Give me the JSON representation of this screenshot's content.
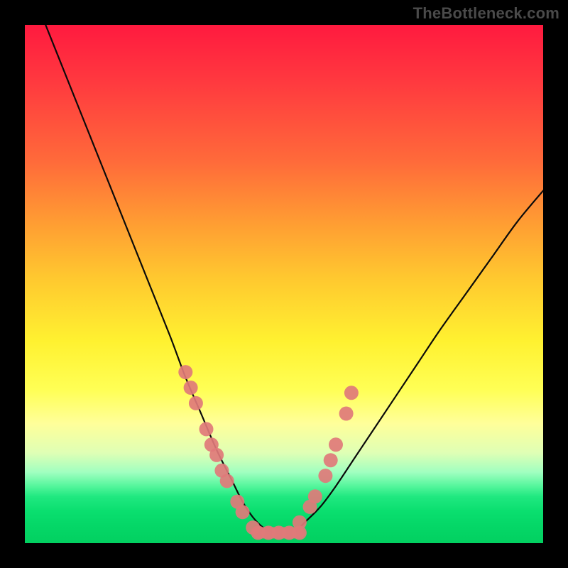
{
  "watermark": "TheBottleneck.com",
  "colors": {
    "background": "#000000",
    "curve_stroke": "#0a0a0a",
    "marker_fill": "#e07a7a",
    "gradient_top": "#ff1a3f",
    "gradient_bottom": "#02d060"
  },
  "chart_data": {
    "type": "line",
    "title": "",
    "xlabel": "",
    "ylabel": "",
    "xlim": [
      0,
      100
    ],
    "ylim": [
      0,
      100
    ],
    "grid": false,
    "series": [
      {
        "name": "left-curve",
        "x": [
          4,
          8,
          12,
          16,
          20,
          24,
          28,
          31,
          34,
          37,
          40,
          42,
          44,
          46,
          48
        ],
        "y": [
          100,
          90,
          80,
          70,
          60,
          50,
          40,
          32,
          25,
          18,
          12,
          8,
          5,
          3,
          2
        ]
      },
      {
        "name": "right-curve",
        "x": [
          52,
          54,
          57,
          60,
          64,
          68,
          72,
          76,
          80,
          85,
          90,
          95,
          100
        ],
        "y": [
          2,
          4,
          7,
          11,
          17,
          23,
          29,
          35,
          41,
          48,
          55,
          62,
          68
        ]
      },
      {
        "name": "markers-left",
        "type": "scatter",
        "x": [
          31,
          32,
          33,
          35,
          36,
          37,
          38,
          39,
          41,
          42,
          44
        ],
        "y": [
          33,
          30,
          27,
          22,
          19,
          17,
          14,
          12,
          8,
          6,
          3
        ]
      },
      {
        "name": "markers-right",
        "type": "scatter",
        "x": [
          53,
          55,
          56,
          58,
          59,
          60,
          62,
          63
        ],
        "y": [
          4,
          7,
          9,
          13,
          16,
          19,
          25,
          29
        ]
      },
      {
        "name": "markers-bottom",
        "type": "scatter",
        "x": [
          45,
          47,
          49,
          51,
          53
        ],
        "y": [
          2,
          2,
          2,
          2,
          2
        ]
      }
    ]
  }
}
